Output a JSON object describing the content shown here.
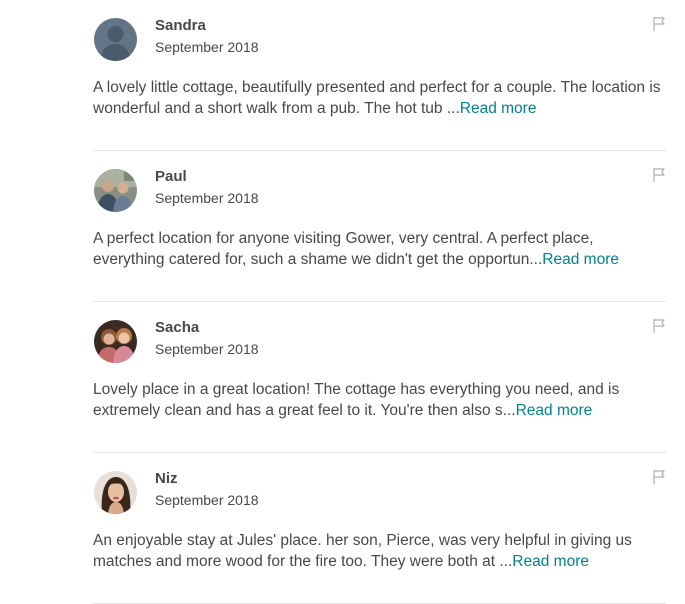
{
  "reviews": [
    {
      "name": "Sandra",
      "date": "September 2018",
      "text": "A lovely little cottage, beautifully presented and perfect for a couple. The location is wonderful and a short walk from a pub. The hot tub ...",
      "read_more": "Read more",
      "avatar": "default-avatar"
    },
    {
      "name": "Paul",
      "date": "September 2018",
      "text": "A perfect location for anyone visiting Gower, very central. A perfect place, everything catered for, such a shame we didn't get the opportun...",
      "read_more": "Read more",
      "avatar": "photo-avatar"
    },
    {
      "name": "Sacha",
      "date": "September 2018",
      "text": "Lovely place in a great location! The cottage has everything you need, and is extremely clean and has a great feel to it. You're then also s...",
      "read_more": "Read more",
      "avatar": "photo-avatar"
    },
    {
      "name": "Niz",
      "date": "September 2018",
      "text": "An enjoyable stay at Jules' place. her son, Pierce, was very helpful in giving us matches and more wood for the fire too. They were both at ...",
      "read_more": "Read more",
      "avatar": "photo-avatar"
    }
  ],
  "colors": {
    "text": "#484848",
    "link": "#008489",
    "divider": "#e4e4e4",
    "flag": "#b0b0b0"
  },
  "icons": {
    "flag": "flag-icon"
  }
}
